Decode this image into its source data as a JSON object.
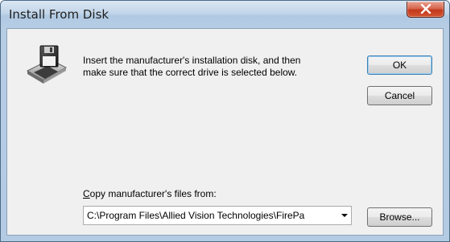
{
  "window": {
    "title": "Install From Disk"
  },
  "message": {
    "line1": "Insert the manufacturer's installation disk, and then",
    "line2": "make sure that the correct drive is selected below."
  },
  "buttons": {
    "ok": "OK",
    "cancel": "Cancel",
    "browse": "Browse..."
  },
  "copy_from": {
    "label_accel": "C",
    "label_rest": "opy manufacturer's files from:",
    "value": "C:\\Program Files\\Allied Vision Technologies\\FirePa"
  },
  "icons": {
    "close": "close-icon",
    "disk": "floppy-disk-drive-icon",
    "dropdown": "chevron-down-icon"
  },
  "colors": {
    "close_button": "#c2391c",
    "default_button_border": "#3c7fb1",
    "titlebar": "#c3d6ea"
  }
}
